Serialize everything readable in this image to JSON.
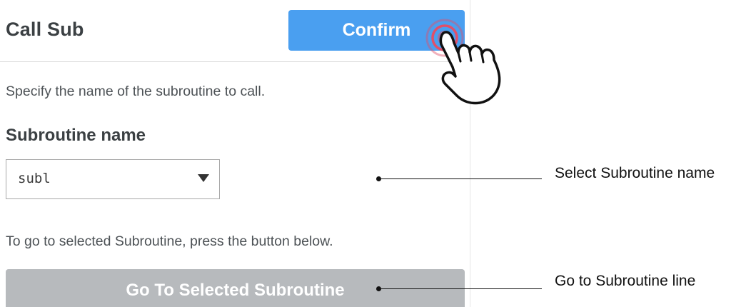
{
  "panel": {
    "title": "Call Sub",
    "confirm_label": "Confirm",
    "description": "Specify the name of the subroutine to call.",
    "subroutine_label": "Subroutine name",
    "subroutine_select": {
      "selected_value": "subl"
    },
    "goto_hint": "To go to selected Subroutine, press the button below.",
    "goto_button_label": "Go To Selected Subroutine"
  },
  "annotations": {
    "select_callout": "Select Subroutine name",
    "goto_callout": "Go to Subroutine line",
    "pointer_icon": "pointing-hand-click-icon"
  },
  "colors": {
    "confirm_button": "#4a9ff0",
    "goto_button_disabled": "#b7babd",
    "click_ring": "#e0506a"
  }
}
